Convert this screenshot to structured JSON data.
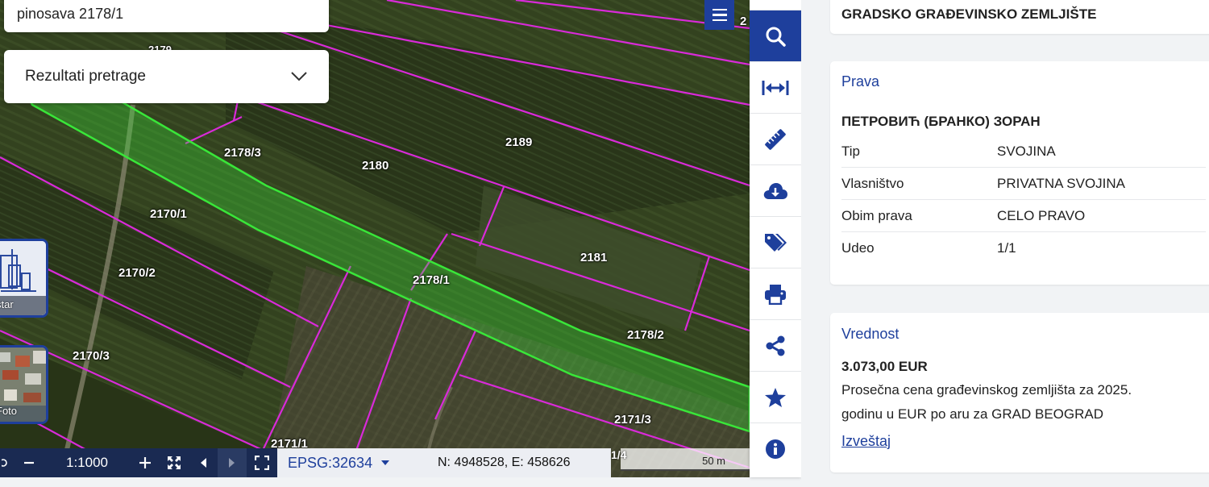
{
  "search": {
    "value": "pinosava 2178/1"
  },
  "results": {
    "label": "Rezultati pretrage"
  },
  "map": {
    "parcel_labels": [
      "2178/3",
      "2180",
      "2189",
      "2170/1",
      "2170/2",
      "2181",
      "2178/1",
      "2178/2",
      "2170/3",
      "2171/3",
      "2171/1",
      "2179",
      "2"
    ],
    "highlight_color": "#39e639",
    "parcel_border_color": "#d92ad9"
  },
  "layers": {
    "cadastre_caption": "star",
    "photo_caption": "Foto"
  },
  "bottom_bar": {
    "scale": "1:1000",
    "epsg": "EPSG:32634",
    "coords": "N: 4948528, E: 458626",
    "scale_bar_label": "50 m",
    "scale_bar_fragment": "1/4"
  },
  "toolbar": {
    "tools": [
      "search-icon",
      "arrows-horizontal-icon",
      "ruler-icon",
      "cloud-download-icon",
      "tags-icon",
      "print-icon",
      "share-icon",
      "star-icon",
      "info-icon"
    ]
  },
  "panel": {
    "top_card": {
      "text": "GRADSKO GRAĐEVINSKO ZEMLJIŠTE"
    },
    "prava": {
      "title": "Prava",
      "owner": "ПЕТРОВИЋ (БРАНКО) ЗОРАН",
      "rows": [
        {
          "key": "Tip",
          "value": "SVOJINA"
        },
        {
          "key": "Vlasništvo",
          "value": "PRIVATNA SVOJINA"
        },
        {
          "key": "Obim prava",
          "value": "CELO PRAVO"
        },
        {
          "key": "Udeo",
          "value": "1/1"
        }
      ]
    },
    "vrednost": {
      "title": "Vrednost",
      "amount": "3.073,00 EUR",
      "desc_line1": "Prosečna cena građevinskog zemljišta za 2025.",
      "desc_line2": "godinu u EUR po aru za GRAD BEOGRAD",
      "link": "Izveštaj"
    }
  },
  "colors": {
    "accent": "#1e3f9c",
    "bar_dark": "#1a2a52"
  }
}
